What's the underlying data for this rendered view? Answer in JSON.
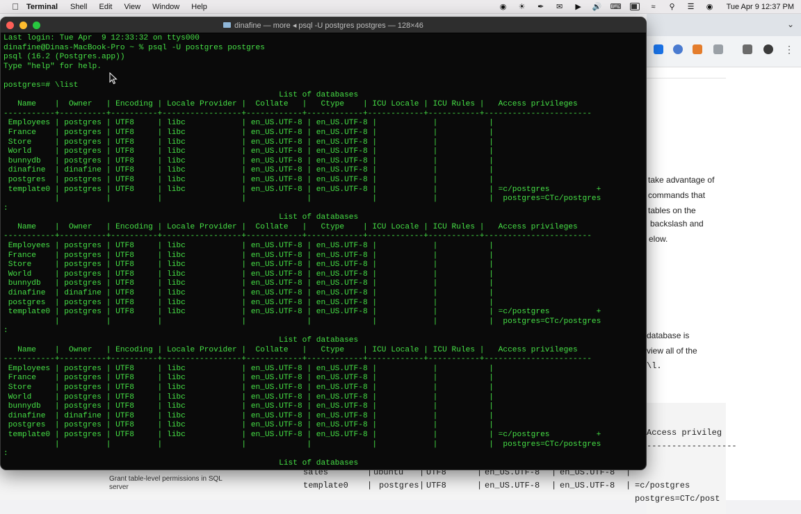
{
  "menubar": {
    "app_name": "Terminal",
    "menus": [
      "Shell",
      "Edit",
      "View",
      "Window",
      "Help"
    ],
    "clock": "Tue Apr 9  12:37 PM"
  },
  "terminal": {
    "title": "dinafine — more ◂ psql -U postgres postgres — 128×46",
    "lines": [
      "Last login: Tue Apr  9 12:33:32 on ttys000",
      "dinafine@Dinas-MacBook-Pro ~ % psql -U postgres postgres",
      "psql (16.2 (Postgres.app))",
      "Type \"help\" for help.",
      "",
      "postgres=# \\list",
      "                                                           List of databases",
      "   Name    |  Owner   | Encoding | Locale Provider |  Collate   |   Ctype    | ICU Locale | ICU Rules |   Access privileges",
      "-----------+----------+----------+-----------------+------------+------------+------------+-----------+-----------------------",
      " Employees | postgres | UTF8     | libc            | en_US.UTF-8 | en_US.UTF-8 |            |           |",
      " France    | postgres | UTF8     | libc            | en_US.UTF-8 | en_US.UTF-8 |            |           |",
      " Store     | postgres | UTF8     | libc            | en_US.UTF-8 | en_US.UTF-8 |            |           |",
      " World     | postgres | UTF8     | libc            | en_US.UTF-8 | en_US.UTF-8 |            |           |",
      " bunnydb   | postgres | UTF8     | libc            | en_US.UTF-8 | en_US.UTF-8 |            |           |",
      " dinafine  | dinafine | UTF8     | libc            | en_US.UTF-8 | en_US.UTF-8 |            |           |",
      " postgres  | postgres | UTF8     | libc            | en_US.UTF-8 | en_US.UTF-8 |            |           |",
      " template0 | postgres | UTF8     | libc            | en_US.UTF-8 | en_US.UTF-8 |            |           | =c/postgres          +",
      "           |          |          |                 |             |             |            |           |  postgres=CTc/postgres",
      ":",
      "                                                           List of databases",
      "   Name    |  Owner   | Encoding | Locale Provider |  Collate   |   Ctype    | ICU Locale | ICU Rules |   Access privileges",
      "-----------+----------+----------+-----------------+------------+------------+------------+-----------+-----------------------",
      " Employees | postgres | UTF8     | libc            | en_US.UTF-8 | en_US.UTF-8 |            |           |",
      " France    | postgres | UTF8     | libc            | en_US.UTF-8 | en_US.UTF-8 |            |           |",
      " Store     | postgres | UTF8     | libc            | en_US.UTF-8 | en_US.UTF-8 |            |           |",
      " World     | postgres | UTF8     | libc            | en_US.UTF-8 | en_US.UTF-8 |            |           |",
      " bunnydb   | postgres | UTF8     | libc            | en_US.UTF-8 | en_US.UTF-8 |            |           |",
      " dinafine  | dinafine | UTF8     | libc            | en_US.UTF-8 | en_US.UTF-8 |            |           |",
      " postgres  | postgres | UTF8     | libc            | en_US.UTF-8 | en_US.UTF-8 |            |           |",
      " template0 | postgres | UTF8     | libc            | en_US.UTF-8 | en_US.UTF-8 |            |           | =c/postgres          +",
      "           |          |          |                 |             |             |            |           |  postgres=CTc/postgres",
      ":",
      "                                                           List of databases",
      "   Name    |  Owner   | Encoding | Locale Provider |  Collate   |   Ctype    | ICU Locale | ICU Rules |   Access privileges",
      "-----------+----------+----------+-----------------+------------+------------+------------+-----------+-----------------------",
      " Employees | postgres | UTF8     | libc            | en_US.UTF-8 | en_US.UTF-8 |            |           |",
      " France    | postgres | UTF8     | libc            | en_US.UTF-8 | en_US.UTF-8 |            |           |",
      " Store     | postgres | UTF8     | libc            | en_US.UTF-8 | en_US.UTF-8 |            |           |",
      " World     | postgres | UTF8     | libc            | en_US.UTF-8 | en_US.UTF-8 |            |           |",
      " bunnydb   | postgres | UTF8     | libc            | en_US.UTF-8 | en_US.UTF-8 |            |           |",
      " dinafine  | dinafine | UTF8     | libc            | en_US.UTF-8 | en_US.UTF-8 |            |           |",
      " postgres  | postgres | UTF8     | libc            | en_US.UTF-8 | en_US.UTF-8 |            |           |",
      " template0 | postgres | UTF8     | libc            | en_US.UTF-8 | en_US.UTF-8 |            |           | =c/postgres          +",
      "           |          |          |                 |             |             |            |           |  postgres=CTc/postgres",
      ":",
      "                                                           List of databases"
    ]
  },
  "browser": {
    "paragraph1": [
      "take advantage of",
      "commands that",
      "tables on the",
      "backslash and",
      "elow."
    ],
    "paragraph2": [
      "database is",
      "view all of the",
      "\\l."
    ],
    "code_header": "Access privileg",
    "code_rule": "------------------"
  },
  "page_bottom": {
    "sidebar_link": [
      "Grant table-level permissions in SQL",
      "server"
    ],
    "row_sales": [
      "sales",
      "|",
      "ubuntu",
      "|",
      "UTF8",
      "|",
      "en_US.UTF-8",
      "|",
      "en_US.UTF-8",
      "|"
    ],
    "row_template0": [
      "template0",
      "|",
      "postgres",
      "|",
      "UTF8",
      "|",
      "en_US.UTF-8",
      "|",
      "en_US.UTF-8",
      "|",
      "=c/postgres"
    ],
    "row_last": "postgres=CTc/post"
  },
  "colors": {
    "terminal_text": "#46e146",
    "terminal_bg": "#0a0a0a"
  }
}
